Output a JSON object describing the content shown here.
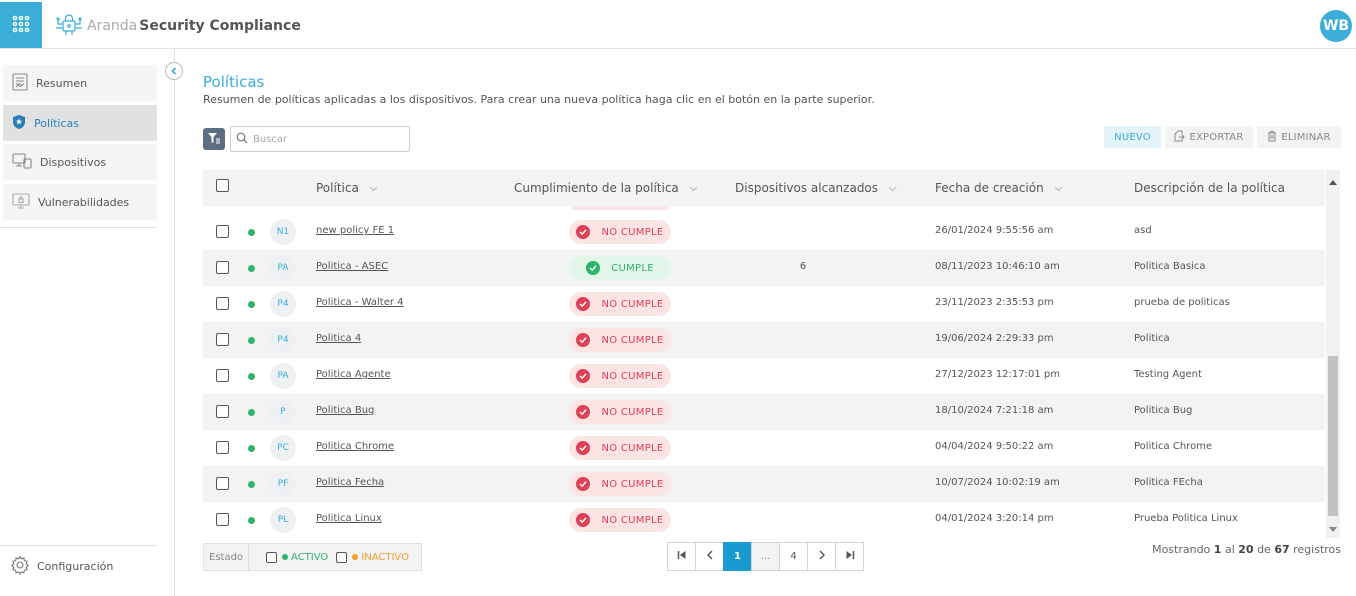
{
  "app": {
    "brand_aranda": "Aranda",
    "brand_product": "Security Compliance",
    "user_initials": "WB",
    "accent_color": "#3aaed8"
  },
  "sidebar": {
    "items": [
      {
        "label": "Resumen",
        "icon": "report-icon",
        "active": false
      },
      {
        "label": "Políticas",
        "icon": "shield-star-icon",
        "active": true
      },
      {
        "label": "Dispositivos",
        "icon": "devices-icon",
        "active": false
      },
      {
        "label": "Vulnerabilidades",
        "icon": "monitor-lock-icon",
        "active": false
      }
    ],
    "config_label": "Configuración"
  },
  "page": {
    "title": "Políticas",
    "subtitle": "Resumen de políticas aplicadas a los dispositivos. Para crear una nueva política haga clic en el botón en la parte superior."
  },
  "toolbar": {
    "search_placeholder": "Buscar",
    "nuevo_label": "NUEVO",
    "exportar_label": "EXPORTAR",
    "eliminar_label": "ELIMINAR"
  },
  "table": {
    "headers": {
      "politica": "Política",
      "cumplimiento": "Cumplimiento de la política",
      "dispositivos": "Dispositivos alcanzados",
      "fecha": "Fecha de creación",
      "descripcion": "Descripción de la política"
    },
    "rows": [
      {
        "badge": "N1",
        "name": "new policy FE 1",
        "status": "NO CUMPLE",
        "compliant": false,
        "devices": "",
        "fecha": "26/01/2024 9:55:56 am",
        "desc": "asd"
      },
      {
        "badge": "PA",
        "name": "Politica - ASEC",
        "status": "CUMPLE",
        "compliant": true,
        "devices": "6",
        "fecha": "08/11/2023 10:46:10 am",
        "desc": "Politica Basica"
      },
      {
        "badge": "P4",
        "name": "Politica - Walter 4",
        "status": "NO CUMPLE",
        "compliant": false,
        "devices": "",
        "fecha": "23/11/2023 2:35:53 pm",
        "desc": "prueba de politicas"
      },
      {
        "badge": "P4",
        "name": "Politica 4",
        "status": "NO CUMPLE",
        "compliant": false,
        "devices": "",
        "fecha": "19/06/2024 2:29:33 pm",
        "desc": "Politica"
      },
      {
        "badge": "PA",
        "name": "Politica Agente",
        "status": "NO CUMPLE",
        "compliant": false,
        "devices": "",
        "fecha": "27/12/2023 12:17:01 pm",
        "desc": "Testing Agent"
      },
      {
        "badge": "P",
        "name": "Politica Bug",
        "status": "NO CUMPLE",
        "compliant": false,
        "devices": "",
        "fecha": "18/10/2024 7:21:18 am",
        "desc": "Politica Bug"
      },
      {
        "badge": "PC",
        "name": "Politica Chrome",
        "status": "NO CUMPLE",
        "compliant": false,
        "devices": "",
        "fecha": "04/04/2024 9:50:22 am",
        "desc": "Politica Chrome"
      },
      {
        "badge": "PF",
        "name": "Politica Fecha",
        "status": "NO CUMPLE",
        "compliant": false,
        "devices": "",
        "fecha": "10/07/2024 10:02:19 am",
        "desc": "Politica FEcha"
      },
      {
        "badge": "PL",
        "name": "Politica Linux",
        "status": "NO CUMPLE",
        "compliant": false,
        "devices": "",
        "fecha": "04/01/2024 3:20:14 pm",
        "desc": "Prueba Politica Linux"
      }
    ]
  },
  "footer": {
    "estado_label": "Estado",
    "activo_label": "ACTIVO",
    "inactivo_label": "INACTIVO",
    "pages": {
      "current": "1",
      "ellipsis": "...",
      "last": "4"
    },
    "showing": {
      "prefix": "Mostrando",
      "from": "1",
      "sep1": "al",
      "to": "20",
      "sep2": "de",
      "total": "67",
      "suffix": "registros"
    }
  }
}
